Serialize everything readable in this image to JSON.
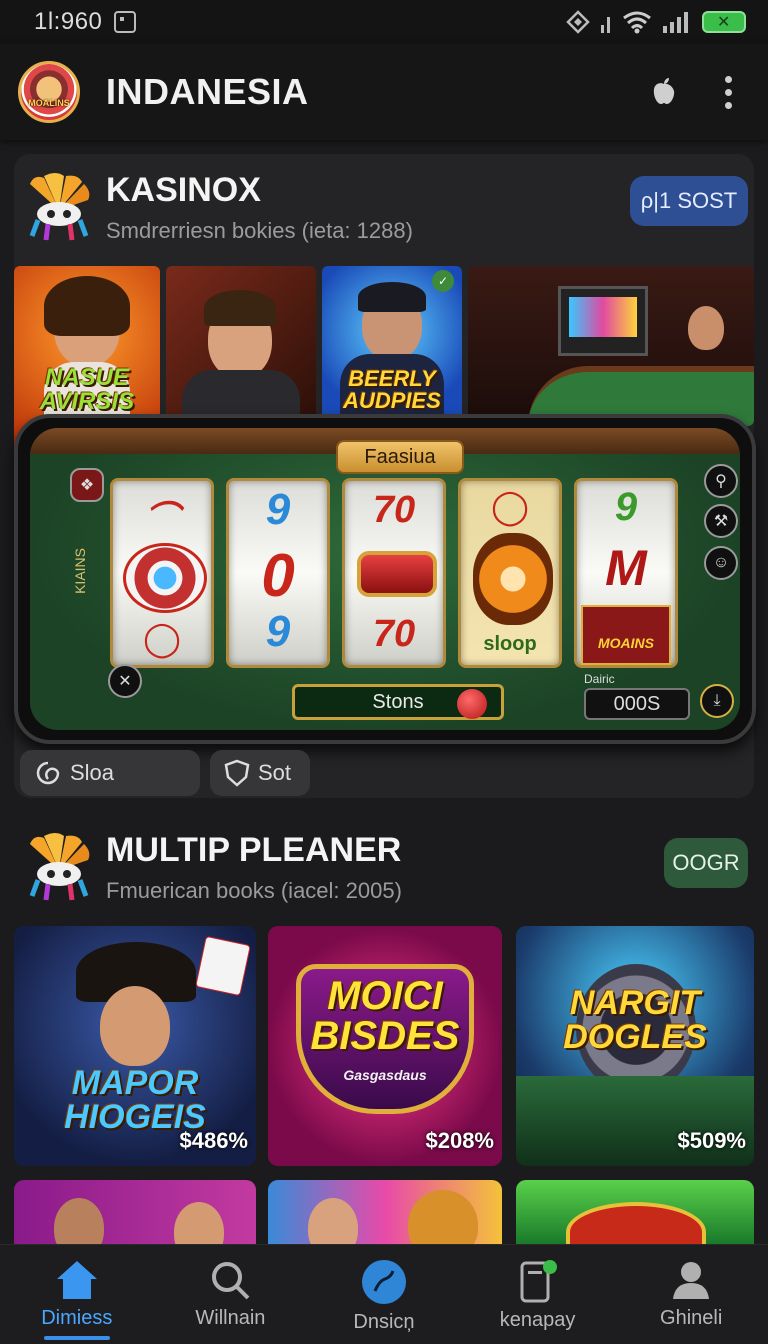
{
  "status_bar": {
    "time": "1l:960"
  },
  "app_bar": {
    "title": "INDANESIA",
    "logo_text": "MOALINS"
  },
  "section1": {
    "title": "KASINOX",
    "subtitle": "Smdrerriesn bokies (ieta: 1288)",
    "action_label": "ρ|1 SOST",
    "action_color": "#2e4f93",
    "tiles": [
      {
        "label": "NASUE AVIRSIS"
      },
      {
        "label": ""
      },
      {
        "label": "BEERLY AUDPIES"
      },
      {
        "label": ""
      }
    ],
    "slot": {
      "name": "Faasiua",
      "side_text": "KIAINS",
      "reels": [
        "№",
        "9",
        "70",
        "sloop",
        "M"
      ],
      "reel_bottom_label": "MOAINS",
      "spin_label": "Stons",
      "credit_label": "Dairic",
      "credit_value": "000S"
    },
    "chips": [
      {
        "label": "Sloa"
      },
      {
        "label": "Sot"
      }
    ]
  },
  "section2": {
    "title": "MULTIP PLEANER",
    "subtitle": "Fmuerican books (iacel:  2005)",
    "action_label": "OOGR",
    "action_color": "#2e5a3b",
    "tiles": [
      {
        "label": "MAPOR HIOGEIS",
        "pct": "$486%"
      },
      {
        "label": "MOICI BISDES",
        "sub": "Gasgasdaus",
        "pct": "$208%"
      },
      {
        "label": "NARGIT DOGLES",
        "pct": "$509%"
      }
    ]
  },
  "bottom_nav": [
    {
      "label": "Dimiess",
      "icon": "home-icon",
      "active": true
    },
    {
      "label": "Willnain",
      "icon": "search-icon",
      "active": false
    },
    {
      "label": "Dnsicņ",
      "icon": "discover-icon",
      "active": false
    },
    {
      "label": "kenapay",
      "icon": "phone-notification-icon",
      "active": false
    },
    {
      "label": "Ghineli",
      "icon": "profile-icon",
      "active": false
    }
  ]
}
